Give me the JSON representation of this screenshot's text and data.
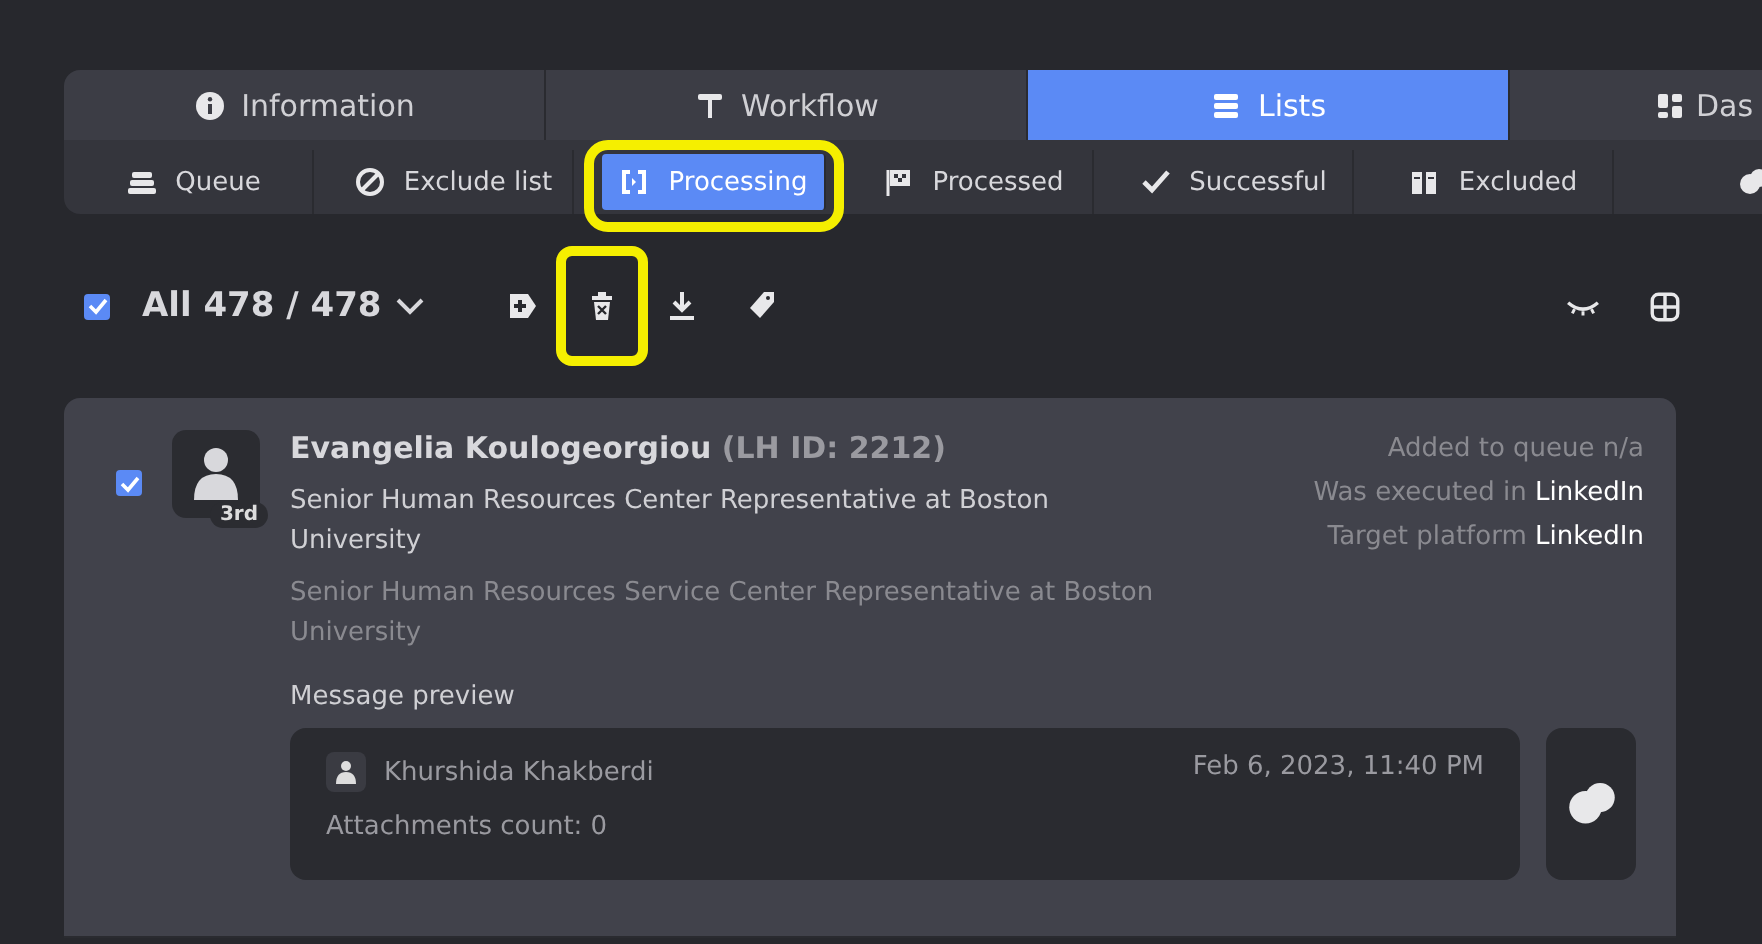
{
  "tabs": [
    {
      "label": "Information",
      "selected": false
    },
    {
      "label": "Workflow",
      "selected": false
    },
    {
      "label": "Lists",
      "selected": true
    },
    {
      "label": "Das",
      "selected": false
    }
  ],
  "subtabs": [
    {
      "label": "Queue",
      "selected": false,
      "highlighted": false
    },
    {
      "label": "Exclude list",
      "selected": false,
      "highlighted": false
    },
    {
      "label": "Processing",
      "selected": true,
      "highlighted": true
    },
    {
      "label": "Processed",
      "selected": false,
      "highlighted": false
    },
    {
      "label": "Successful",
      "selected": false,
      "highlighted": false
    },
    {
      "label": "Excluded",
      "selected": false,
      "highlighted": false
    },
    {
      "selected": false,
      "highlighted": false
    }
  ],
  "toolbar": {
    "select_all": {
      "checked": true,
      "label": "All 478 / 478"
    },
    "actions": [
      {
        "highlighted": false
      },
      {
        "highlighted": true
      },
      {
        "highlighted": false
      },
      {
        "highlighted": false
      }
    ]
  },
  "leads": [
    {
      "checked": true,
      "name": "Evangelia Koulogeorgiou",
      "lh_id": "(LH ID: 2212)",
      "degree": "3rd",
      "headline": "Senior Human Resources Center Representative at Boston University",
      "position": "Senior Human Resources Service Center Representative at Boston University",
      "meta": [
        {
          "label": "Added to queue n/a"
        },
        {
          "label": "Was executed in",
          "value": "LinkedIn"
        },
        {
          "label": "Target platform",
          "value": "LinkedIn"
        }
      ],
      "message_preview": {
        "title": "Message preview",
        "sender": "Khurshida Khakberdi",
        "date": "Feb 6, 2023, 11:40 PM",
        "attachments": "Attachments count: 0"
      }
    }
  ]
}
